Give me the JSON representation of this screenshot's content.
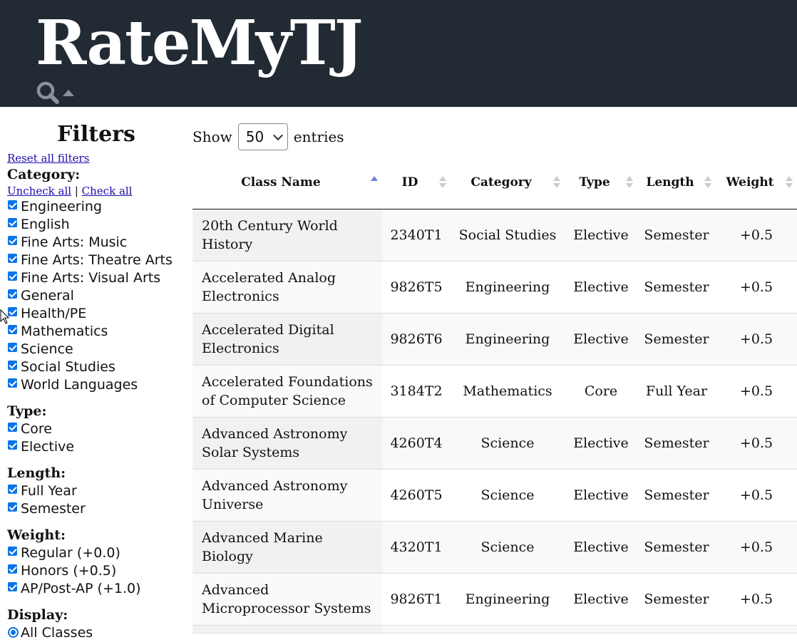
{
  "header": {
    "title": "RateMyTJ",
    "search_icon": "magnifier-icon",
    "toggle_icon": "caret-up-icon"
  },
  "sidebar": {
    "title": "Filters",
    "reset_label": "Reset all filters",
    "category": {
      "label": "Category:",
      "uncheck_all": "Uncheck all",
      "separator": "|",
      "check_all": "Check all",
      "options": [
        "Engineering",
        "English",
        "Fine Arts: Music",
        "Fine Arts: Theatre Arts",
        "Fine Arts: Visual Arts",
        "General",
        "Health/PE",
        "Mathematics",
        "Science",
        "Social Studies",
        "World Languages"
      ]
    },
    "type": {
      "label": "Type:",
      "options": [
        "Core",
        "Elective"
      ]
    },
    "length": {
      "label": "Length:",
      "options": [
        "Full Year",
        "Semester"
      ]
    },
    "weight": {
      "label": "Weight:",
      "options": [
        "Regular (+0.0)",
        "Honors (+0.5)",
        "AP/Post-AP (+1.0)"
      ]
    },
    "display": {
      "label": "Display:",
      "selected": "All Classes"
    }
  },
  "table_controls": {
    "show_label": "Show",
    "page_size": "50",
    "entries_label": "entries"
  },
  "table": {
    "columns": [
      "Class Name",
      "ID",
      "Category",
      "Type",
      "Length",
      "Weight"
    ],
    "sort_column": "Class Name",
    "sort_direction": "ascending",
    "rows": [
      [
        "20th Century World History",
        "2340T1",
        "Social Studies",
        "Elective",
        "Semester",
        "+0.5"
      ],
      [
        "Accelerated Analog Electronics",
        "9826T5",
        "Engineering",
        "Elective",
        "Semester",
        "+0.5"
      ],
      [
        "Accelerated Digital Electronics",
        "9826T6",
        "Engineering",
        "Elective",
        "Semester",
        "+0.5"
      ],
      [
        "Accelerated Foundations of Computer Science",
        "3184T2",
        "Mathematics",
        "Core",
        "Full Year",
        "+0.5"
      ],
      [
        "Advanced Astronomy Solar Systems",
        "4260T4",
        "Science",
        "Elective",
        "Semester",
        "+0.5"
      ],
      [
        "Advanced Astronomy Universe",
        "4260T5",
        "Science",
        "Elective",
        "Semester",
        "+0.5"
      ],
      [
        "Advanced Marine Biology",
        "4320T1",
        "Science",
        "Elective",
        "Semester",
        "+0.5"
      ],
      [
        "Advanced Microprocessor Systems",
        "9826T1",
        "Engineering",
        "Elective",
        "Semester",
        "+0.5"
      ]
    ]
  }
}
